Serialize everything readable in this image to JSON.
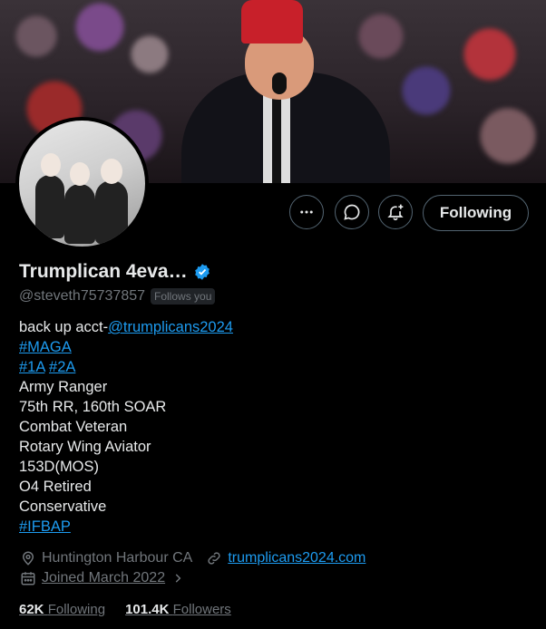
{
  "profile": {
    "display_name": "Trumplican 4eva…",
    "handle": "@steveth75737857",
    "follows_you": "Follows you",
    "verified": true,
    "verified_color": "#1d9bf0"
  },
  "actions": {
    "more_icon": "more-horizontal-icon",
    "message_icon": "message-icon",
    "notify_icon": "bell-plus-icon",
    "following_label": "Following"
  },
  "bio": {
    "line1_text": "back up acct-",
    "line1_link": "@trumplicans2024",
    "line2": "#MAGA",
    "line3_a": "#1A",
    "line3_b": "#2A",
    "line4": "Army Ranger",
    "line5": "75th RR, 160th SOAR",
    "line6": "Combat Veteran",
    "line7": "Rotary Wing Aviator",
    "line8": "153D(MOS)",
    "line9": "O4 Retired",
    "line10": "Conservative",
    "line11": "#IFBAP"
  },
  "meta": {
    "location": "Huntington Harbour CA",
    "website": "trumplicans2024.com",
    "joined": "Joined March 2022"
  },
  "stats": {
    "following_count": "62K",
    "following_label": "Following",
    "followers_count": "101.4K",
    "followers_label": "Followers"
  },
  "colors": {
    "link": "#1d9bf0",
    "muted": "#71767b",
    "text": "#e7e9ea",
    "background": "#000000"
  }
}
